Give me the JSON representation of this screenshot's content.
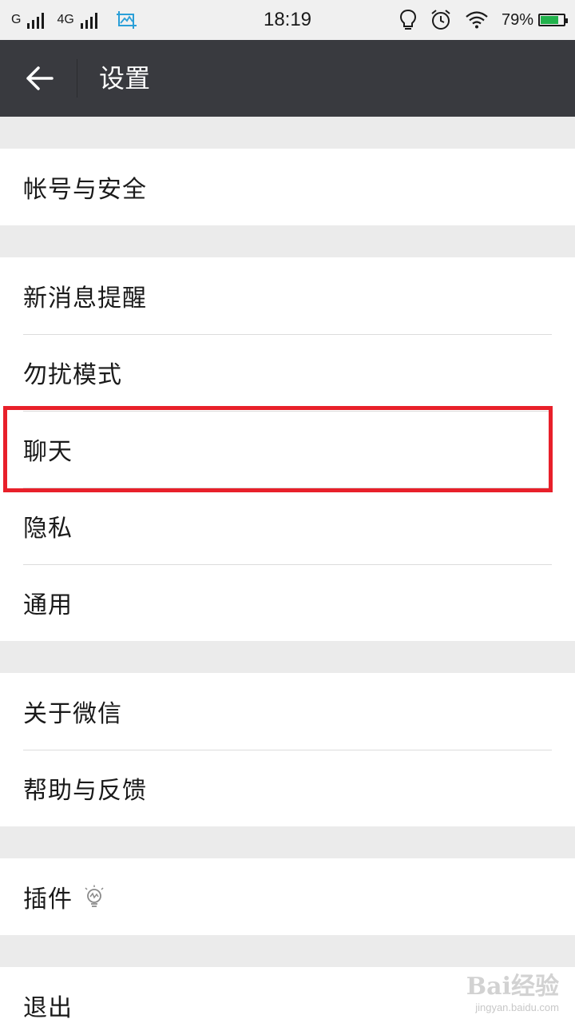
{
  "status_bar": {
    "network_1": "G",
    "network_2": "4G",
    "time": "18:19",
    "battery_percent": "79%",
    "battery_level": 0.79
  },
  "header": {
    "title": "设置"
  },
  "groups": [
    {
      "items": [
        {
          "label": "帐号与安全"
        }
      ]
    },
    {
      "items": [
        {
          "label": "新消息提醒"
        },
        {
          "label": "勿扰模式"
        },
        {
          "label": "聊天"
        },
        {
          "label": "隐私"
        },
        {
          "label": "通用"
        }
      ]
    },
    {
      "items": [
        {
          "label": "关于微信"
        },
        {
          "label": "帮助与反馈"
        }
      ]
    },
    {
      "items": [
        {
          "label": "插件",
          "icon": "lightbulb-icon"
        }
      ]
    },
    {
      "items": [
        {
          "label": "退出"
        }
      ]
    }
  ],
  "highlighted_item": "聊天",
  "watermark": {
    "brand": "Bai经验",
    "url": "jingyan.baidu.com"
  },
  "colors": {
    "title_bar": "#393a3f",
    "highlight": "#e8202a",
    "battery": "#22b24c",
    "background": "#ebebeb"
  }
}
